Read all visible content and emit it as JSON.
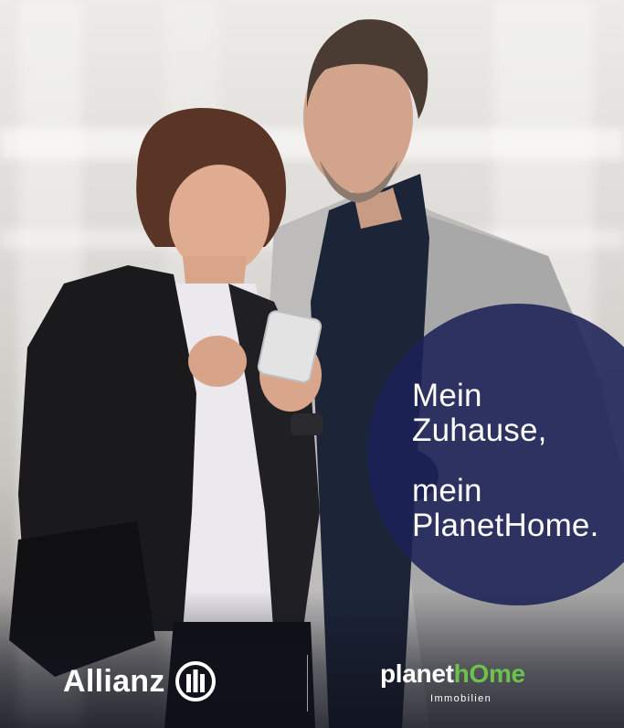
{
  "headline": {
    "line1": "Mein",
    "line2": "Zuhause,",
    "line3": "mein",
    "line4": "PlanetHome."
  },
  "allianz": {
    "name": "Allianz"
  },
  "planethome": {
    "part1": "planet",
    "part2": "hOme",
    "subtitle": "Immobilien"
  },
  "colors": {
    "circle": "#1b2157",
    "planethome_green": "#6cc24a",
    "text": "#ffffff"
  }
}
